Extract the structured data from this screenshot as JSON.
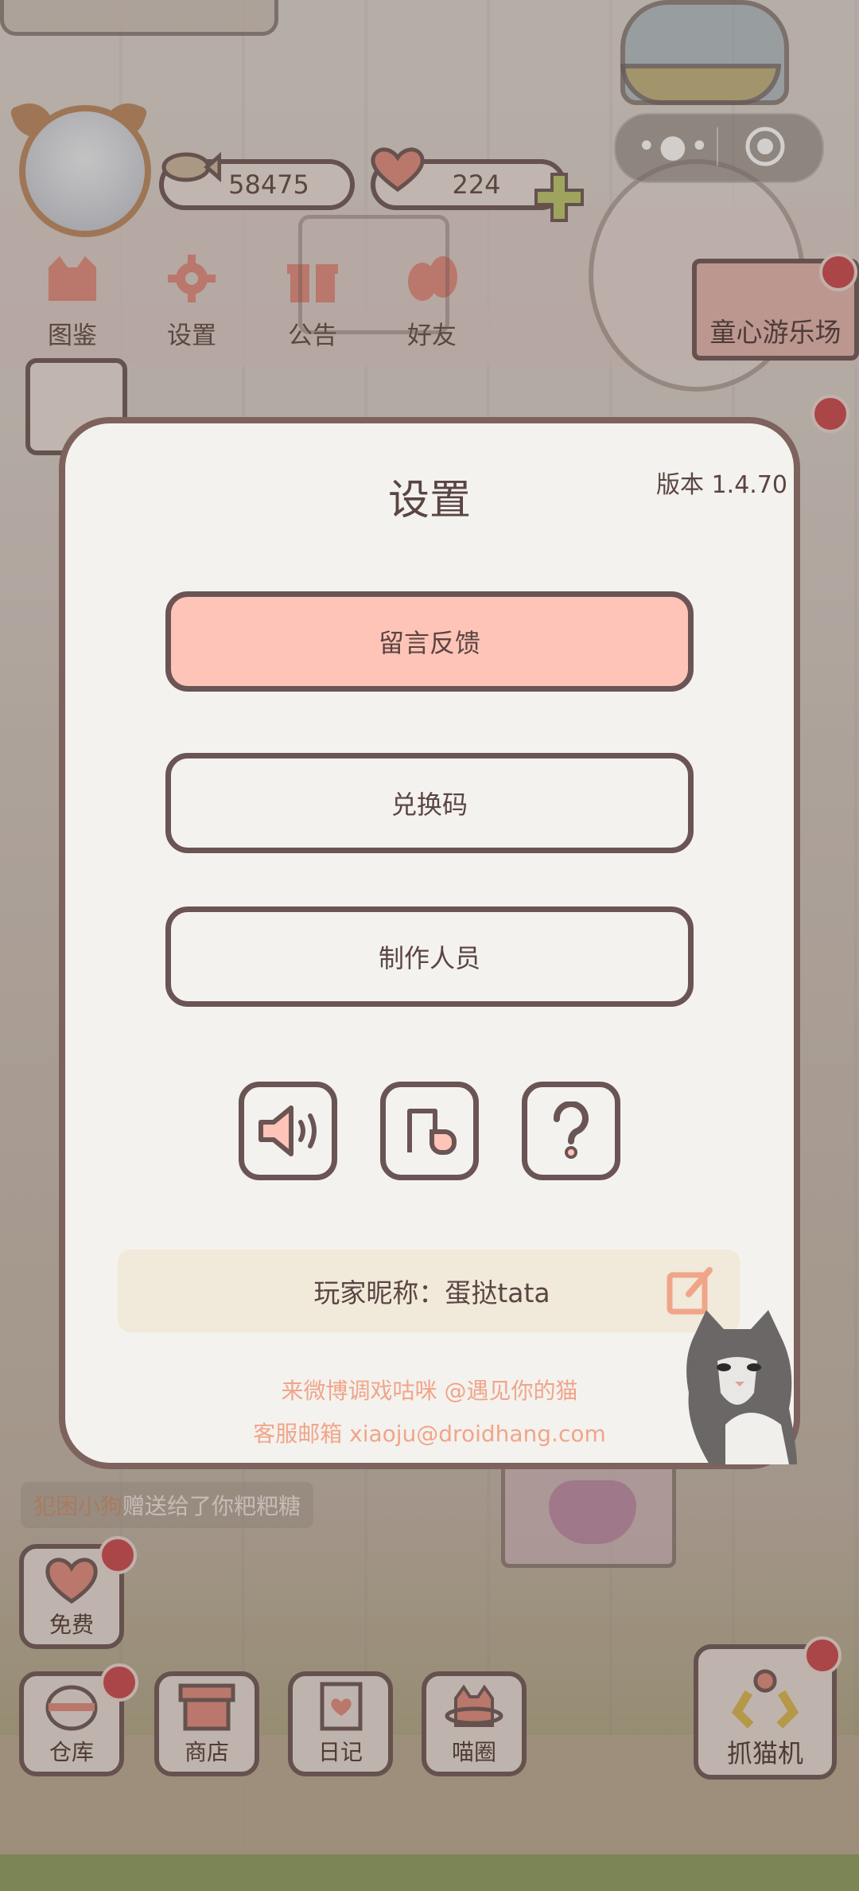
{
  "hud": {
    "fish_count": "58475",
    "heart_count": "224"
  },
  "nav": [
    {
      "label": "图鉴",
      "icon": "cat-face-icon"
    },
    {
      "label": "设置",
      "icon": "gear-icon"
    },
    {
      "label": "公告",
      "icon": "gift-icon"
    },
    {
      "label": "好友",
      "icon": "friends-icon"
    }
  ],
  "amusement_park_label": "童心游乐场",
  "chat": {
    "sender": "犯困小狗",
    "message": "赠送给了你粑粑糖"
  },
  "dock": {
    "free_label": "免费",
    "warehouse_label": "仓库",
    "shop_label": "商店",
    "diary_label": "日记",
    "circle_label": "喵圈",
    "claw_machine_label": "抓猫机"
  },
  "modal": {
    "title": "设置",
    "version": "版本 1.4.70",
    "feedback_label": "留言反馈",
    "redeem_label": "兑换码",
    "credits_label": "制作人员",
    "nickname_text": "玩家昵称：蛋挞tata",
    "weibo_text": "来微博调戏咕咪 @遇见你的猫",
    "email_text": "客服邮箱 xiaoju@droidhang.com"
  },
  "colors": {
    "outline": "#6a5454",
    "primary_button": "#fec4b7",
    "modal_bg": "#f4f2ee",
    "accent_orange": "#f0a58a",
    "notification_red": "#c9434a"
  }
}
